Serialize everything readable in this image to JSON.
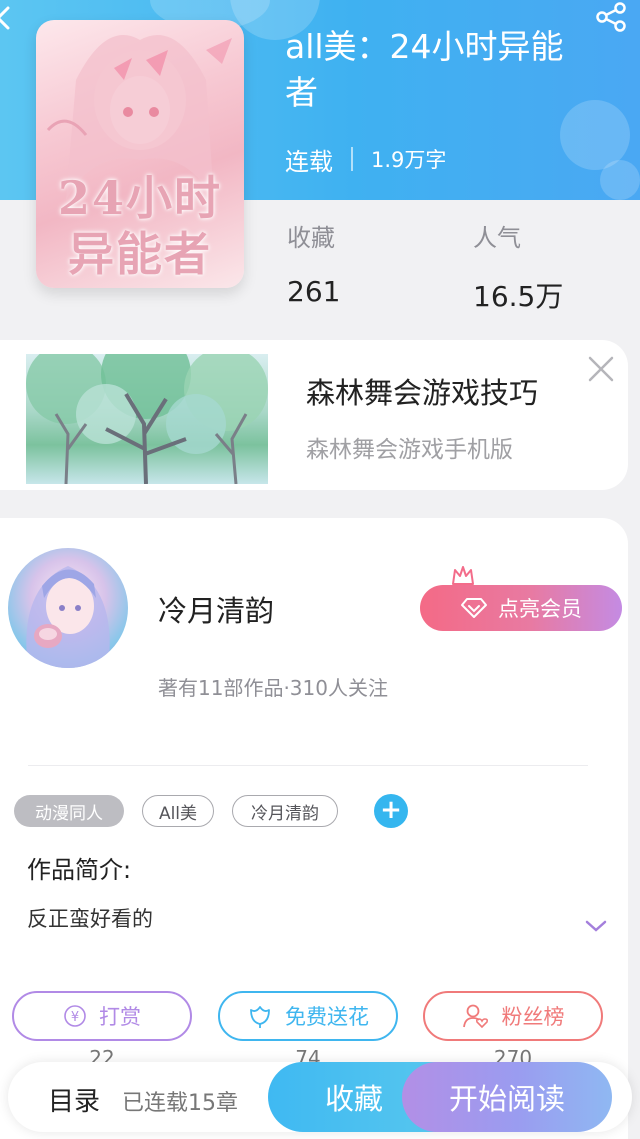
{
  "book": {
    "title": "all美：24小时异能者",
    "status": "连载",
    "word_count": "1.9万字",
    "cover_text": "24小时异能者",
    "stats": [
      {
        "label": "收藏",
        "value": "261"
      },
      {
        "label": "人气",
        "value": "16.5万"
      }
    ]
  },
  "ad": {
    "title": "森林舞会游戏技巧",
    "subtitle": "森林舞会游戏手机版"
  },
  "author": {
    "name": "冷月清韵",
    "meta": "著有11部作品·310人关注",
    "vip_button": "点亮会员"
  },
  "tags": [
    "动漫同人",
    "All美",
    "冷月清韵"
  ],
  "intro": {
    "heading": "作品简介:",
    "text": "反正蛮好看的"
  },
  "actions": [
    {
      "label": "打赏",
      "count": "22",
      "color": "#b18ae6"
    },
    {
      "label": "免费送花",
      "count": "74",
      "color": "#3fb6ef"
    },
    {
      "label": "粉丝榜",
      "count": "270",
      "color": "#f07a7a"
    }
  ],
  "bottom_bar": {
    "toc": "目录",
    "chapters": "已连载15章",
    "favorite": "收藏",
    "read": "开始阅读"
  },
  "colors": {
    "header_blue": "#3fb1f1",
    "accent_purple": "#b28fe6",
    "vip_pink": "#f46a86"
  }
}
